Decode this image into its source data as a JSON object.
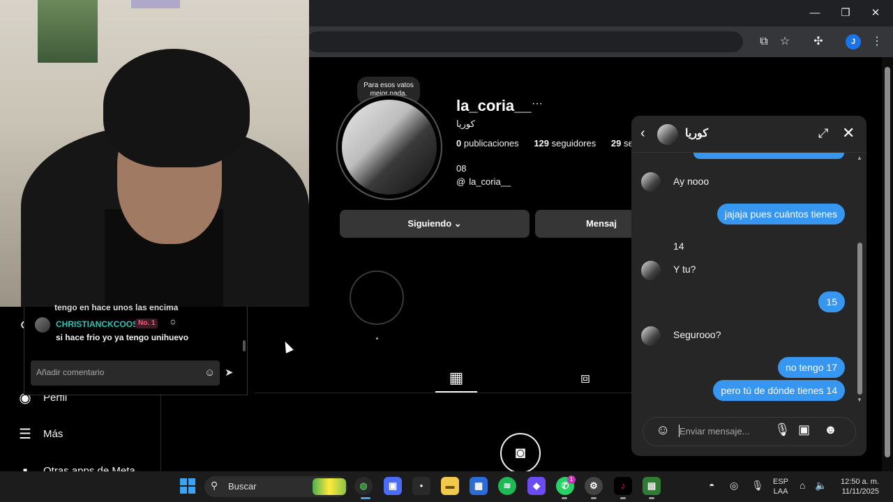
{
  "browser": {
    "window_controls": {
      "minimize": "—",
      "restore": "❐",
      "close": "✕"
    },
    "profile_initial": "J"
  },
  "nav": {
    "items": [
      {
        "label": "Perfil"
      },
      {
        "label": "Más"
      },
      {
        "label": "Otras apps de Meta"
      }
    ]
  },
  "profile": {
    "note": "Para esos vatos mejor nada.",
    "username": "la_coria__",
    "more": "···",
    "full_name": "كوريا",
    "posts_count": "0",
    "posts_label": "publicaciones",
    "followers_count": "129",
    "followers_label": "seguidores",
    "following_count": "29",
    "following_label": "segu",
    "bio": "08",
    "threads_handle": "la_coria__",
    "following_button": "Siguiendo",
    "message_button": "Mensaj"
  },
  "live": {
    "cut_text": "tengo en hace unos las encima",
    "user": "CHRISTIANCKCOOS",
    "badge": "No. 1",
    "comment": "si hace frio yo ya tengo unihuevo",
    "input_placeholder": "Añadir comentario"
  },
  "chat": {
    "contact_name": "كوريا",
    "messages": [
      {
        "dir": "in",
        "text": "Ay nooo",
        "avatar": true
      },
      {
        "dir": "out",
        "text": "jajaja pues cuántos tienes"
      },
      {
        "dir": "in",
        "text": "14",
        "avatar": false
      },
      {
        "dir": "in",
        "text": "Y tu?",
        "avatar": true
      },
      {
        "dir": "out",
        "text": "15"
      },
      {
        "dir": "in",
        "text": "Segurooo?",
        "avatar": true
      },
      {
        "dir": "out",
        "text": "no tengo 17"
      },
      {
        "dir": "out",
        "text": "pero tú de dónde tienes 14"
      }
    ],
    "input_placeholder": "Enviar mensaje..."
  },
  "taskbar": {
    "search_label": "Buscar",
    "whatsapp_badge": "1",
    "lang_top": "ESP",
    "lang_bottom": "LAA",
    "time": "12:50 a. m.",
    "date": "11/11/2025"
  }
}
